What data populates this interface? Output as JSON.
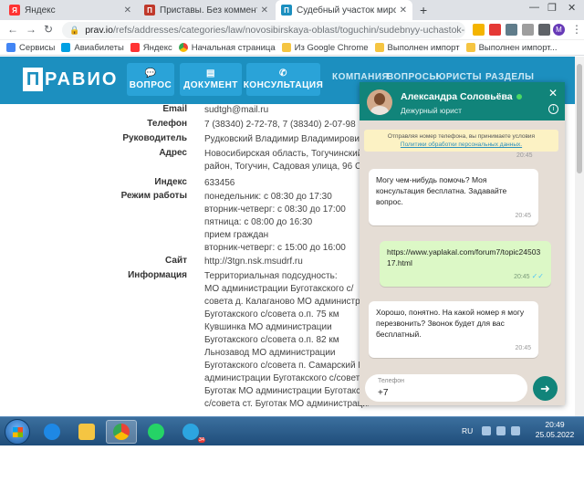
{
  "browser": {
    "tabs": [
      {
        "title": "Яндекс",
        "favicon": "yandex-icon",
        "color": "#ff3333"
      },
      {
        "title": "Приставы. Без комментариев, и",
        "favicon": "pikabu-icon",
        "color": "#c0392b"
      },
      {
        "title": "Судебный участок мирового су",
        "favicon": "pravio-icon",
        "color": "#1c8fbf"
      }
    ],
    "new_tab": "+",
    "url_host": "prav.io",
    "url_path": "/refs/addresses/categories/law/novosibirskaya-oblast/toguchin/sudebnyy-uchastok-...",
    "bookmarks": [
      {
        "label": "Сервисы",
        "icon": "apps-icon"
      },
      {
        "label": "Авиабилеты",
        "icon": "plane-icon"
      },
      {
        "label": "Яндекс",
        "icon": "yandex-icon"
      },
      {
        "label": "Начальная страница",
        "icon": "chrome-icon"
      },
      {
        "label": "Из Google Chrome",
        "icon": "folder-icon"
      },
      {
        "label": "Выполнен импорт",
        "icon": "folder-icon"
      },
      {
        "label": "Выполнен импорт...",
        "icon": "folder-icon"
      }
    ]
  },
  "site": {
    "logo_letter": "П",
    "logo_rest": "РАВИО",
    "header_buttons": [
      {
        "label": "ВОПРОС",
        "icon": "chat-icon"
      },
      {
        "label": "ДОКУМЕНТ",
        "icon": "document-icon"
      },
      {
        "label": "КОНСУЛЬТАЦИЯ",
        "icon": "phone-icon"
      }
    ],
    "menu": [
      "КОМПАНИЯ",
      "ВОПРОСЫ",
      "ЮРИСТЫ",
      "РАЗДЕЛЫ"
    ]
  },
  "court": {
    "email_label": "Email",
    "email": "sudtgh@mail.ru",
    "phone_label": "Телефон",
    "phone": "7 (38340) 2-72-78, 7 (38340) 2-07-98",
    "head_label": "Руководитель",
    "head": "Рудковский Владимир Владимирович",
    "address_label": "Адрес",
    "address_lines": [
      "Новосибирская область, Тогучинский",
      "район, Тогучин, Садовая улица, 96 Суд"
    ],
    "index_label": "Индекс",
    "index": "633456",
    "hours_label": "Режим работы",
    "hours_lines": [
      "понедельник: с 08:30 до 17:30",
      "вторник-четверг: с 08:30 до 17:00",
      "пятница: с 08:00 до 16:30",
      "прием граждан",
      "вторник-четверг: с 15:00 до 16:00"
    ],
    "site_label": "Сайт",
    "site": "http://3tgn.nsk.msudrf.ru",
    "info_label": "Информация",
    "info_lines": [
      "Территориальная подсудность:",
      "МО администрации Буготакского с/",
      "совета д. Калаганово МО администрац",
      "Буготакского с/совета о.п. 75 км",
      "Кувшинка МО администрации",
      "Буготакского с/совета о.п. 82 км",
      "Льнозавод МО администрации",
      "Буготакского с/совета п. Самарский МО",
      "администрации Буготакского с/совета с",
      "Буготак МО администрации Буготакского",
      "с/совета ст. Буготак МО администрации"
    ]
  },
  "chat": {
    "agent_name": "Александра Соловьёва",
    "agent_role": "Дежурный юрист",
    "notice_text": "Отправляя номер телефона, вы принимаете условия",
    "notice_link": "Политики обработки персональных данных.",
    "prev_time": "20:45",
    "messages": [
      {
        "dir": "in",
        "text": "Могу чем-нибудь помочь? Моя консультация бесплатна. Задавайте вопрос.",
        "time": "20:45"
      },
      {
        "dir": "out",
        "text": "https://www.yaplakal.com/forum7/topic2450317.html",
        "time": "20:45"
      },
      {
        "dir": "in",
        "text": "Хорошо, понятно. На какой номер я могу перезвонить? Звонок будет для вас бесплатный.",
        "time": "20:45"
      }
    ],
    "phone_label": "Телефон",
    "phone_value": "+7"
  },
  "taskbar": {
    "apps": [
      "ie-icon",
      "explorer-icon",
      "chrome-icon",
      "whatsapp-icon",
      "telegram-icon"
    ],
    "telegram_badge": "34",
    "lang": "RU",
    "time": "20:49",
    "date": "25.05.2022"
  },
  "colors": {
    "brand": "#1c8fbf",
    "chat_header": "#11847a",
    "chat_bg": "#e5ddd5",
    "outgoing": "#dcf8c6"
  }
}
